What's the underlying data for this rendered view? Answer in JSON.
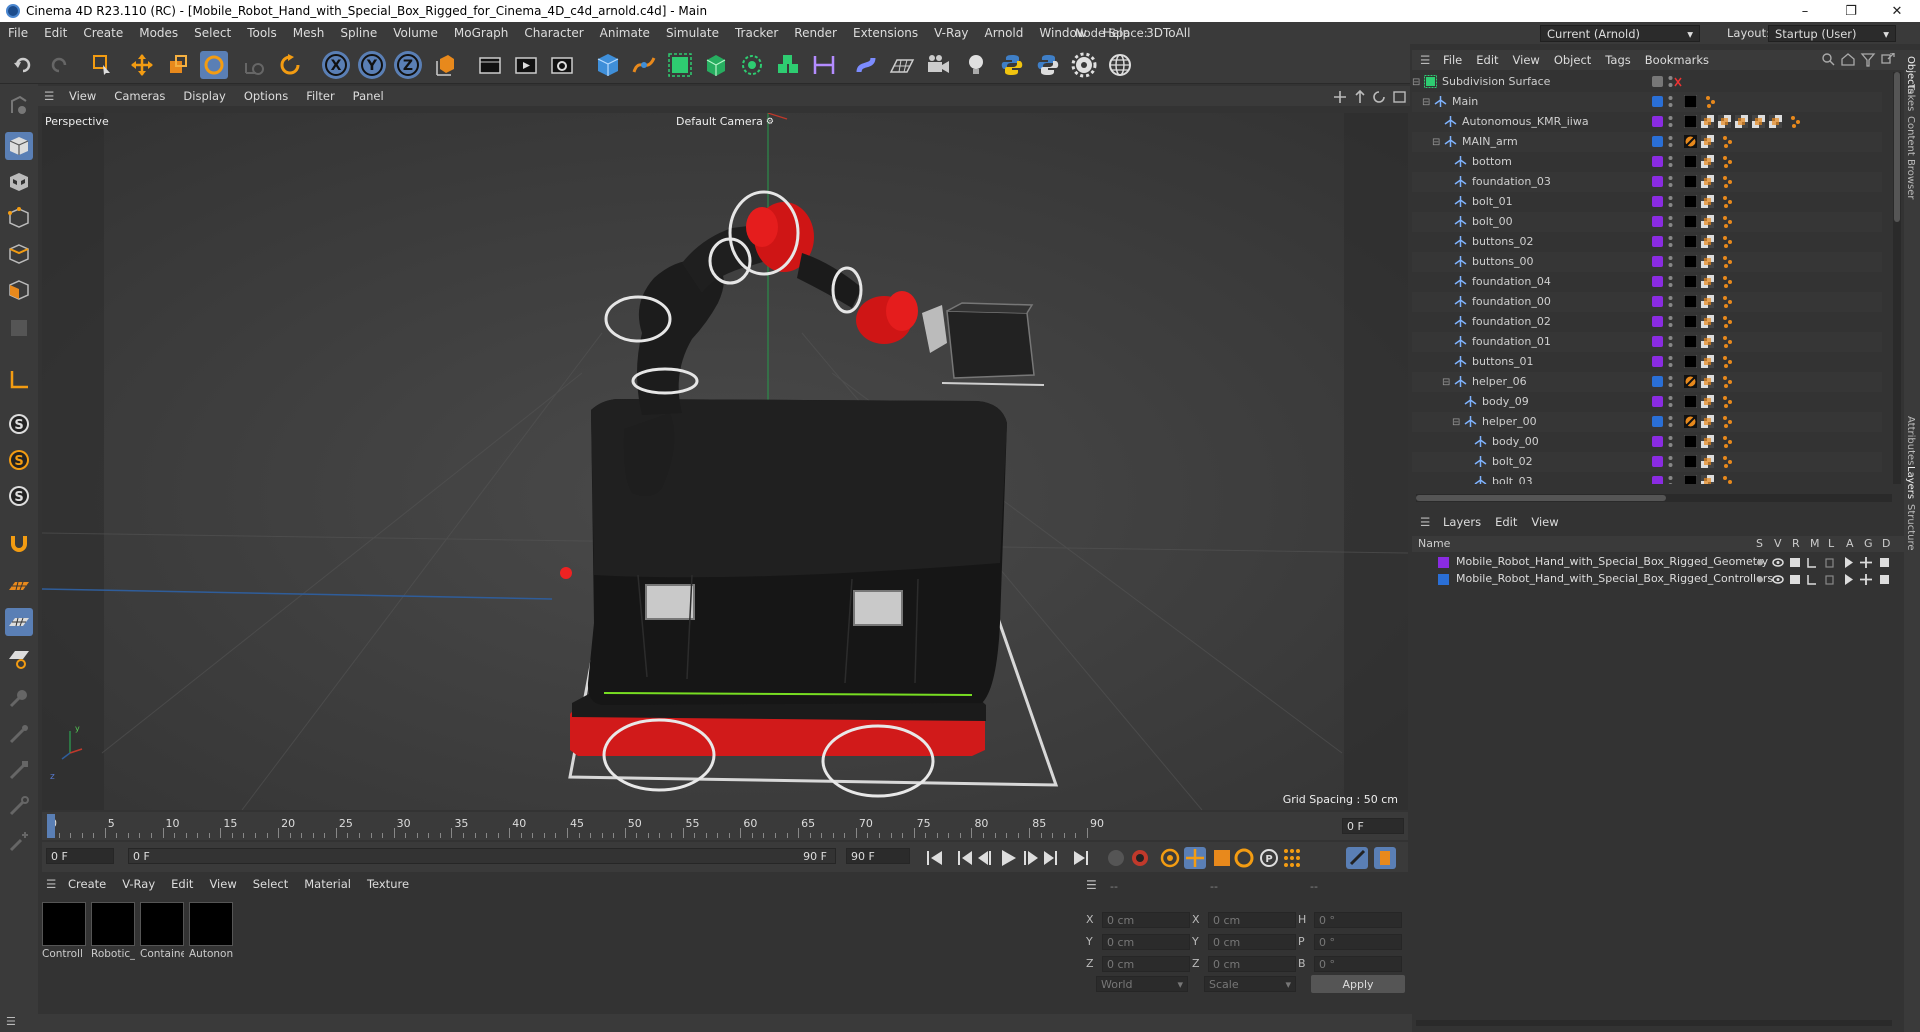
{
  "window": {
    "title": "Cinema 4D R23.110 (RC) - [Mobile_Robot_Hand_with_Special_Box_Rigged_for_Cinema_4D_c4d_arnold.c4d] - Main",
    "minimize": "–",
    "maximize": "❐",
    "close": "✕"
  },
  "menu": [
    "File",
    "Edit",
    "Create",
    "Modes",
    "Select",
    "Tools",
    "Mesh",
    "Spline",
    "Volume",
    "MoGraph",
    "Character",
    "Animate",
    "Simulate",
    "Tracker",
    "Render",
    "Extensions",
    "V-Ray",
    "Arnold",
    "Window",
    "Help",
    "3DToAll"
  ],
  "node_space": {
    "label": "Node Space:",
    "value": "Current (Arnold)"
  },
  "layout": {
    "label": "Layout:",
    "value": "Startup (User)"
  },
  "viewport": {
    "menu": [
      "View",
      "Cameras",
      "Display",
      "Options",
      "Filter",
      "Panel"
    ],
    "name": "Perspective",
    "camera": "Default Camera",
    "grid_spacing": "Grid Spacing : 50 cm"
  },
  "timeline": {
    "ticks": [
      "0",
      "5",
      "10",
      "15",
      "20",
      "25",
      "30",
      "35",
      "40",
      "45",
      "50",
      "55",
      "60",
      "65",
      "70",
      "75",
      "80",
      "85",
      "90"
    ],
    "current_frame": "0 F"
  },
  "transport": {
    "start": "0 F",
    "current": "0 F",
    "end": "90 F",
    "end_field": "90 F"
  },
  "material_panel": {
    "menu": [
      "Create",
      "V-Ray",
      "Edit",
      "View",
      "Select",
      "Material",
      "Texture"
    ],
    "materials": [
      "Controll",
      "Robotic_",
      "Containe",
      "Autonon"
    ]
  },
  "coords": {
    "headers": [
      "--",
      "--",
      "--"
    ],
    "rows": [
      {
        "a": "X",
        "v1": "0 cm",
        "b": "X",
        "v2": "0 cm",
        "c": "H",
        "v3": "0 °"
      },
      {
        "a": "Y",
        "v1": "0 cm",
        "b": "Y",
        "v2": "0 cm",
        "c": "P",
        "v3": "0 °"
      },
      {
        "a": "Z",
        "v1": "0 cm",
        "b": "Z",
        "v2": "0 cm",
        "c": "B",
        "v3": "0 °"
      }
    ],
    "world": "World",
    "scale": "Scale",
    "apply": "Apply"
  },
  "object_manager": {
    "menu": [
      "File",
      "Edit",
      "View",
      "Object",
      "Tags",
      "Bookmarks"
    ],
    "objects": [
      {
        "name": "Subdivision Surface",
        "depth": 0,
        "color": "",
        "tags": 0
      },
      {
        "name": "Main",
        "depth": 1,
        "color": "#2a6fd6",
        "tags": 1
      },
      {
        "name": "Autonomous_KMR_iiwa",
        "depth": 2,
        "color": "#8a2be2",
        "tags": 6
      },
      {
        "name": "MAIN_arm",
        "depth": 2,
        "color": "#2a6fd6",
        "tags": 2
      },
      {
        "name": "bottom",
        "depth": 3,
        "color": "#8a2be2",
        "tags": 2
      },
      {
        "name": "foundation_03",
        "depth": 3,
        "color": "#8a2be2",
        "tags": 2
      },
      {
        "name": "bolt_01",
        "depth": 3,
        "color": "#8a2be2",
        "tags": 2
      },
      {
        "name": "bolt_00",
        "depth": 3,
        "color": "#8a2be2",
        "tags": 2
      },
      {
        "name": "buttons_02",
        "depth": 3,
        "color": "#8a2be2",
        "tags": 2
      },
      {
        "name": "buttons_00",
        "depth": 3,
        "color": "#8a2be2",
        "tags": 2
      },
      {
        "name": "foundation_04",
        "depth": 3,
        "color": "#8a2be2",
        "tags": 2
      },
      {
        "name": "foundation_00",
        "depth": 3,
        "color": "#8a2be2",
        "tags": 2
      },
      {
        "name": "foundation_02",
        "depth": 3,
        "color": "#8a2be2",
        "tags": 2
      },
      {
        "name": "foundation_01",
        "depth": 3,
        "color": "#8a2be2",
        "tags": 2
      },
      {
        "name": "buttons_01",
        "depth": 3,
        "color": "#8a2be2",
        "tags": 2
      },
      {
        "name": "helper_06",
        "depth": 3,
        "color": "#2a6fd6",
        "tags": 2
      },
      {
        "name": "body_09",
        "depth": 4,
        "color": "#8a2be2",
        "tags": 2
      },
      {
        "name": "helper_00",
        "depth": 4,
        "color": "#2a6fd6",
        "tags": 2
      },
      {
        "name": "body_00",
        "depth": 5,
        "color": "#8a2be2",
        "tags": 2
      },
      {
        "name": "bolt_02",
        "depth": 5,
        "color": "#8a2be2",
        "tags": 2
      },
      {
        "name": "bolt_03",
        "depth": 5,
        "color": "#8a2be2",
        "tags": 2
      }
    ]
  },
  "layer_manager": {
    "menu": [
      "Layers",
      "Edit",
      "View"
    ],
    "name_header": "Name",
    "columns": [
      "S",
      "V",
      "R",
      "M",
      "L",
      "A",
      "G",
      "D"
    ],
    "layers": [
      {
        "name": "Mobile_Robot_Hand_with_Special_Box_Rigged_Geometry",
        "color": "#8a2be2"
      },
      {
        "name": "Mobile_Robot_Hand_with_Special_Box_Rigged_Controllers",
        "color": "#2a6fd6"
      }
    ]
  },
  "side_tabs": [
    "Objects",
    "Takes",
    "Content Browser",
    "Attributes",
    "Layers",
    "Structure"
  ]
}
